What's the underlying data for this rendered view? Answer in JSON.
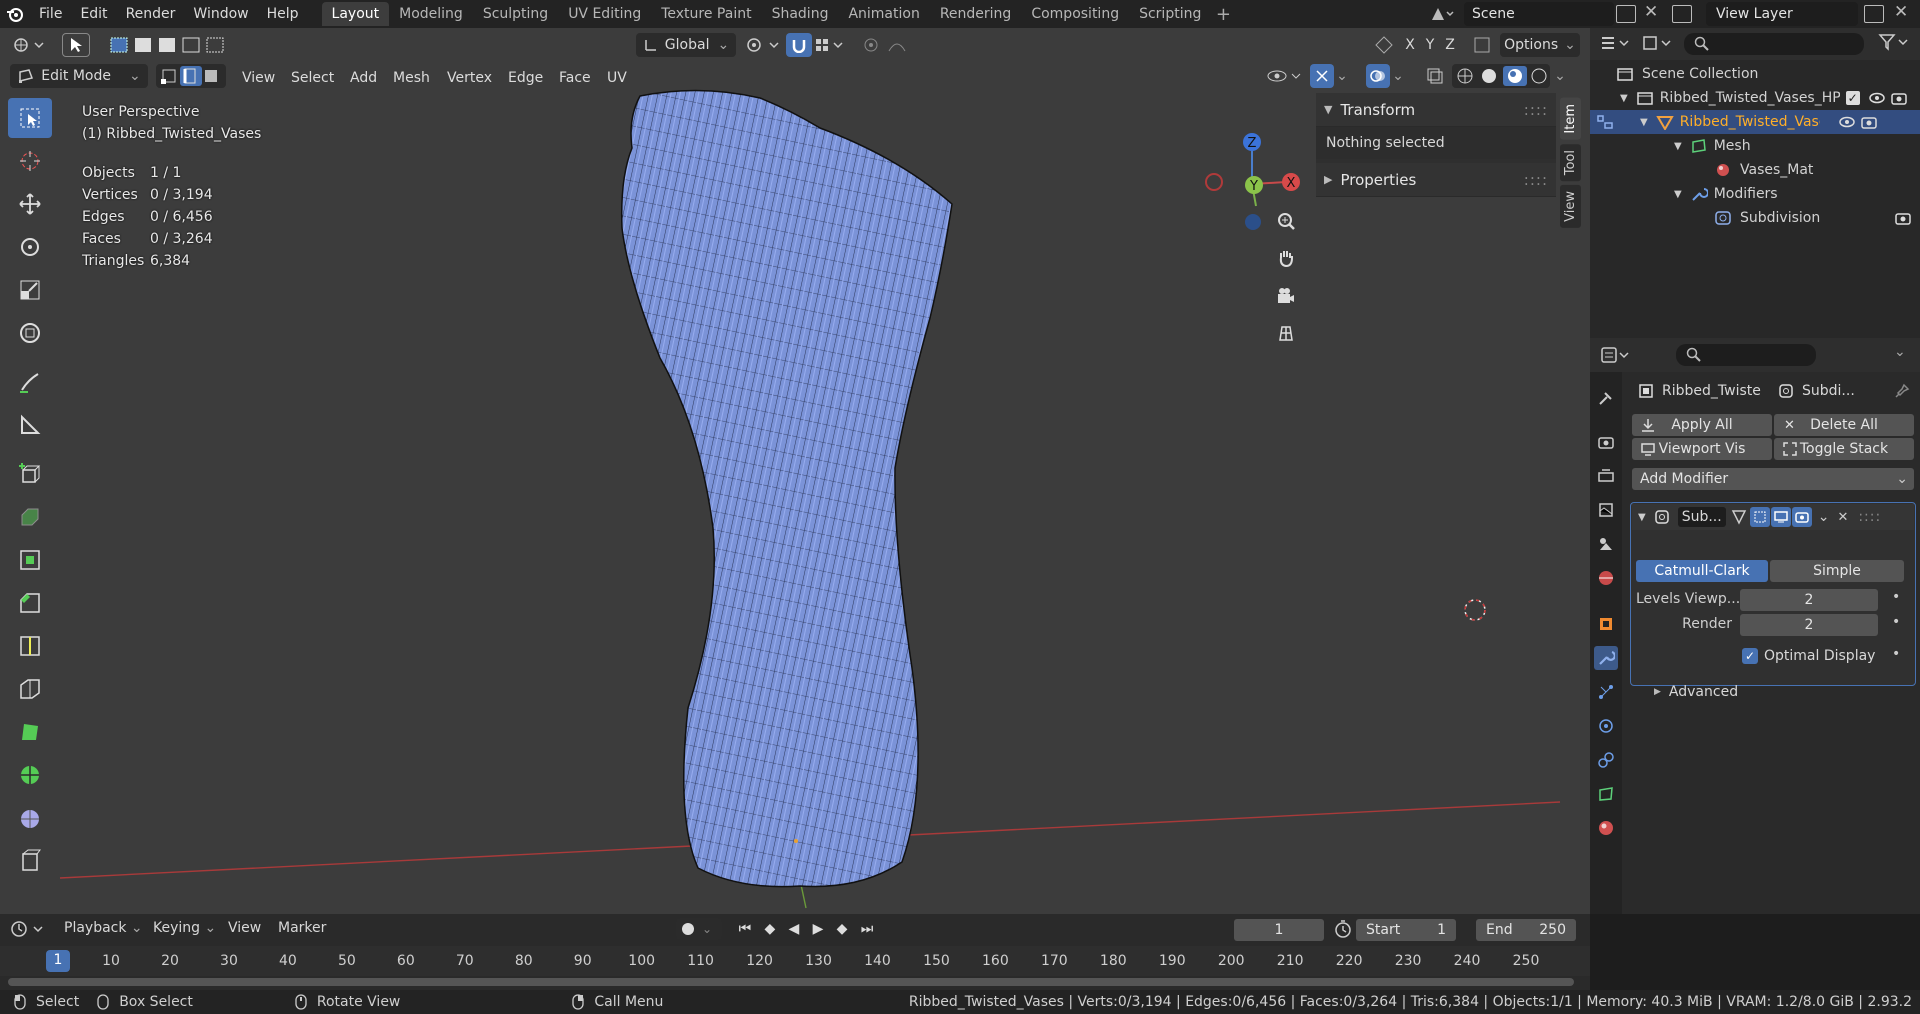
{
  "topbar": {
    "menus": [
      "File",
      "Edit",
      "Render",
      "Window",
      "Help"
    ],
    "workspaces": [
      "Layout",
      "Modeling",
      "Sculpting",
      "UV Editing",
      "Texture Paint",
      "Shading",
      "Animation",
      "Rendering",
      "Compositing",
      "Scripting"
    ],
    "active_workspace": "Layout",
    "scene": "Scene",
    "view_layer": "View Layer"
  },
  "viewport": {
    "mode": "Edit Mode",
    "menus": [
      "View",
      "Select",
      "Add",
      "Mesh",
      "Vertex",
      "Edge",
      "Face",
      "UV"
    ],
    "orientation": "Global",
    "options_label": "Options",
    "axes": [
      "X",
      "Y",
      "Z"
    ],
    "perspective": "User Perspective",
    "object_label": "(1) Ribbed_Twisted_Vases",
    "stats": [
      {
        "label": "Objects",
        "value": "1 / 1"
      },
      {
        "label": "Vertices",
        "value": "0 / 3,194"
      },
      {
        "label": "Edges",
        "value": "0 / 6,456"
      },
      {
        "label": "Faces",
        "value": "0 / 3,264"
      },
      {
        "label": "Triangles",
        "value": "6,384"
      }
    ],
    "gizmo": {
      "z": "Z",
      "x": "X",
      "y": "Y"
    },
    "n_panel": {
      "transform_title": "Transform",
      "nothing_selected": "Nothing selected",
      "properties_title": "Properties",
      "tabs": [
        "Item",
        "Tool",
        "View"
      ]
    },
    "colors": {
      "mesh": "#7b93d8",
      "bg": "#3c3c3c",
      "accent": "#4772b3"
    }
  },
  "outliner": {
    "root": "Scene Collection",
    "collection": "Ribbed_Twisted_Vases_HP",
    "object": "Ribbed_Twisted_Vases",
    "mesh": "Mesh",
    "material": "Vases_Mat",
    "modifiers": "Modifiers",
    "modifier": "Subdivision"
  },
  "properties": {
    "object_name": "Ribbed_Twiste",
    "modifier_short": "Subdi...",
    "apply_all": "Apply All",
    "delete_all": "Delete All",
    "viewport_vis": "Viewport Vis",
    "toggle_stack": "Toggle Stack",
    "add_modifier": "Add Modifier",
    "mod_name": "Sub...",
    "catmull": "Catmull-Clark",
    "simple": "Simple",
    "levels_label": "Levels Viewp...",
    "levels_value": "2",
    "render_label": "Render",
    "render_value": "2",
    "optimal_display": "Optimal Display",
    "advanced": "Advanced"
  },
  "timeline": {
    "menus": [
      "Playback",
      "Keying",
      "View",
      "Marker"
    ],
    "current_frame": "1",
    "start_label": "Start",
    "start_value": "1",
    "end_label": "End",
    "end_value": "250",
    "ticks": [
      "1",
      "10",
      "20",
      "30",
      "40",
      "50",
      "60",
      "70",
      "80",
      "90",
      "100",
      "110",
      "120",
      "130",
      "140",
      "150",
      "160",
      "170",
      "180",
      "190",
      "200",
      "210",
      "220",
      "230",
      "240",
      "250"
    ]
  },
  "statusbar": {
    "select": "Select",
    "box_select": "Box Select",
    "rotate_view": "Rotate View",
    "call_menu": "Call Menu",
    "info": "Ribbed_Twisted_Vases | Verts:0/3,194 | Edges:0/6,456 | Faces:0/3,264 | Tris:6,384 | Objects:1/1 | Memory: 40.3 MiB | VRAM: 1.2/8.0 GiB | 2.93.2"
  }
}
